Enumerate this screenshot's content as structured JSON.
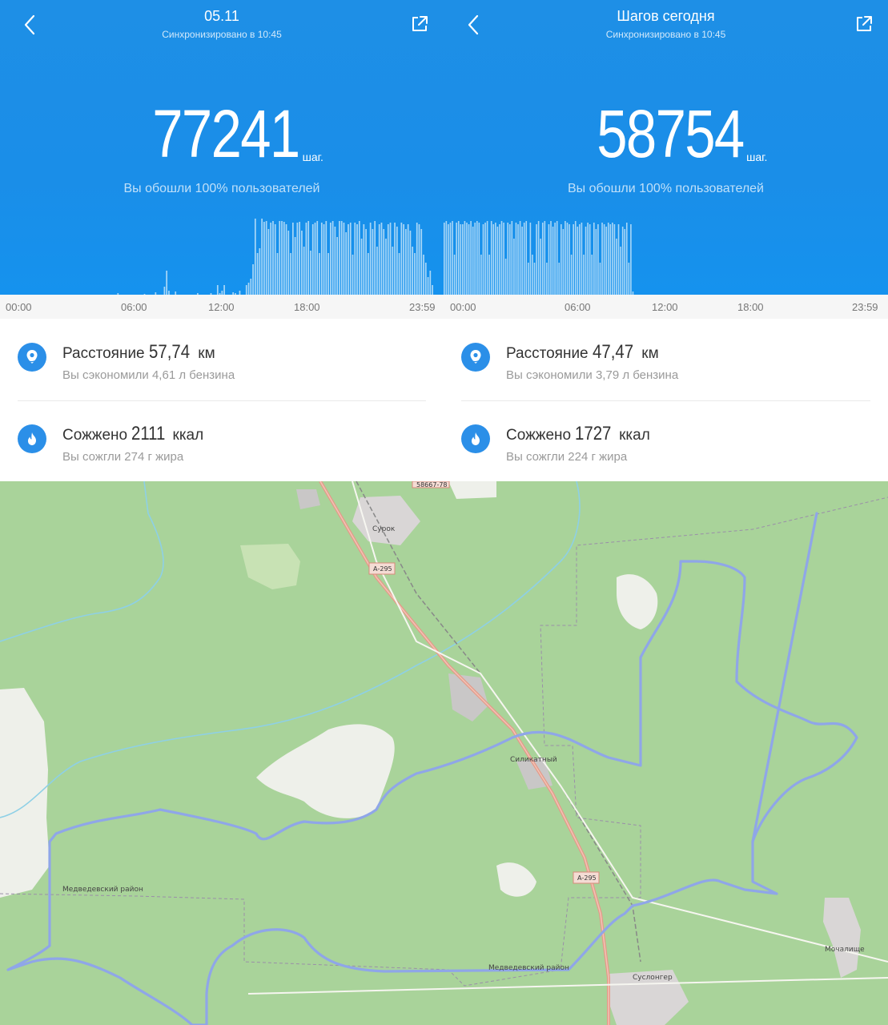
{
  "left": {
    "title": "05.11",
    "sync": "Синхронизировано в 10:45",
    "steps": "77241",
    "steps_unit": "шаг.",
    "beat": "Вы обошли 100% пользователей",
    "ticks": [
      "00:00",
      "06:00",
      "12:00",
      "18:00",
      "23:59"
    ],
    "distance_label": "Расстояние",
    "distance_value": "57,74",
    "distance_unit": "км",
    "distance_sub": "Вы сэкономили 4,61 л бензина",
    "burn_label": "Сожжено",
    "burn_value": "2111",
    "burn_unit": "ккал",
    "burn_sub": "Вы сожгли 274 г жира"
  },
  "right": {
    "title": "Шагов сегодня",
    "sync": "Синхронизировано в 10:45",
    "steps": "58754",
    "steps_unit": "шаг.",
    "beat": "Вы обошли 100% пользователей",
    "ticks": [
      "00:00",
      "06:00",
      "12:00",
      "18:00",
      "23:59"
    ],
    "distance_label": "Расстояние",
    "distance_value": "47,47",
    "distance_unit": "км",
    "distance_sub": "Вы сэкономили 3,79 л бензина",
    "burn_label": "Сожжено",
    "burn_value": "1727",
    "burn_unit": "ккал",
    "burn_sub": "Вы сожгли 224 г жира"
  },
  "icons": {
    "back": "chevron-left-icon",
    "share": "share-icon",
    "distance": "location-pin-icon",
    "burn": "flame-icon"
  },
  "colors": {
    "header_blue": "#1e8fe6",
    "bar_color": "#a9d7f7",
    "icon_blue": "#2b8fe8",
    "map_green": "#a9d39a",
    "route": "#8fa6e8",
    "road": "#e59a88"
  },
  "chart_data": [
    {
      "type": "bar",
      "categories_range": [
        "00:00",
        "23:59"
      ],
      "values": [
        0,
        0,
        0,
        0,
        0,
        0,
        0,
        0,
        0,
        0,
        0,
        0,
        0,
        0,
        0,
        0,
        0,
        0,
        0,
        0,
        0,
        0,
        0,
        0,
        0,
        0,
        0,
        0,
        0,
        0,
        0,
        0,
        0,
        0,
        0,
        0,
        0,
        0,
        0,
        0,
        0,
        0,
        0,
        0,
        0,
        2,
        0,
        0,
        0,
        0,
        0,
        0,
        0,
        0,
        0,
        0,
        0,
        1,
        0,
        0,
        0,
        0,
        3,
        0,
        0,
        0,
        10,
        30,
        5,
        0,
        0,
        4,
        0,
        0,
        0,
        0,
        0,
        0,
        0,
        0,
        0,
        2,
        0,
        0,
        0,
        0,
        0,
        2,
        0,
        0,
        12,
        2,
        5,
        12,
        0,
        0,
        0,
        3,
        2,
        0,
        5,
        0,
        0,
        12,
        15,
        20,
        38,
        95,
        52,
        58,
        95,
        91,
        92,
        82,
        90,
        92,
        88,
        52,
        92,
        92,
        91,
        88,
        80,
        52,
        90,
        72,
        90,
        91,
        80,
        60,
        90,
        92,
        55,
        88,
        90,
        92,
        52,
        90,
        88,
        92,
        52,
        90,
        92,
        85,
        72,
        92,
        92,
        90,
        78,
        88,
        90,
        50,
        90,
        88,
        92,
        70,
        88,
        82,
        52,
        90,
        82,
        92,
        60,
        88,
        90,
        82,
        70,
        88,
        90,
        60,
        90,
        85,
        52,
        90,
        88,
        82,
        88,
        80,
        60,
        52,
        90,
        88,
        82,
        50,
        40,
        22,
        30,
        12
      ]
    },
    {
      "type": "bar",
      "categories_range": [
        "00:00",
        "23:59"
      ],
      "values": [
        90,
        92,
        88,
        90,
        92,
        50,
        90,
        92,
        88,
        88,
        92,
        90,
        88,
        92,
        85,
        90,
        92,
        90,
        50,
        88,
        90,
        92,
        50,
        92,
        88,
        90,
        85,
        88,
        92,
        90,
        45,
        90,
        88,
        92,
        70,
        90,
        88,
        92,
        85,
        90,
        92,
        40,
        90,
        50,
        40,
        88,
        92,
        70,
        90,
        92,
        40,
        88,
        92,
        85,
        90,
        92,
        40,
        88,
        82,
        92,
        90,
        88,
        50,
        88,
        92,
        85,
        88,
        90,
        50,
        85,
        90,
        88,
        50,
        90,
        82,
        88,
        40,
        90,
        88,
        85,
        90,
        88,
        90,
        88,
        70,
        88,
        60,
        85,
        82,
        90,
        40,
        88,
        4,
        0,
        0,
        0,
        0,
        0,
        0,
        0,
        0,
        0,
        0,
        0,
        0,
        0,
        0,
        0,
        0,
        0,
        0,
        0,
        0,
        0,
        0,
        0,
        0,
        0,
        0,
        0,
        0,
        0,
        0,
        0,
        0,
        0,
        0,
        0,
        0,
        0,
        0,
        0,
        0,
        0,
        0,
        0,
        0,
        0,
        0,
        0,
        0,
        0,
        0,
        0,
        0,
        0,
        0,
        0,
        0,
        0,
        0,
        0,
        0,
        0,
        0,
        0,
        0,
        0,
        0,
        0,
        0,
        0,
        0,
        0,
        0,
        0,
        0,
        0,
        0,
        0,
        0,
        0,
        0,
        0,
        0,
        0,
        0,
        0,
        0,
        0,
        0,
        0,
        0,
        0,
        0,
        0,
        0,
        0,
        0,
        0,
        0,
        0,
        0,
        0,
        0,
        0,
        0,
        0,
        0,
        0,
        0,
        0,
        0
      ]
    }
  ],
  "map": {
    "labels": [
      "Сурок",
      "А-295",
      "58667-78",
      "Силикатный",
      "А-295",
      "Медведевский район",
      "Медведевский район",
      "Мочалище",
      "Суслонгер"
    ]
  }
}
